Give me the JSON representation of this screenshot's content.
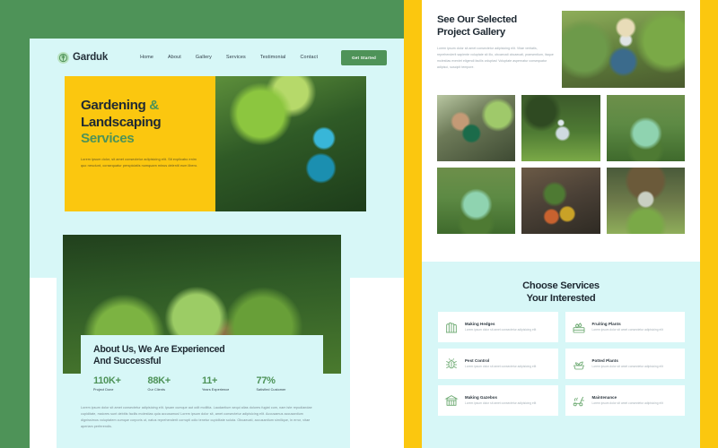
{
  "colors": {
    "frame_green": "#4e9358",
    "page_cyan": "#d7f7f7",
    "accent_yellow": "#fbc70f",
    "brand_green": "#4e9358",
    "heading_dark": "#1f2a33",
    "white": "#ffffff"
  },
  "navbar": {
    "brand_name": "Garduk",
    "brand_icon": "leaf-circle-icon",
    "links": [
      {
        "label": "Home"
      },
      {
        "label": "About"
      },
      {
        "label": "Gallery"
      },
      {
        "label": "Services"
      },
      {
        "label": "Testimonial"
      },
      {
        "label": "Contact"
      }
    ],
    "cta_label": "Get Started"
  },
  "hero": {
    "title_line1": "Gardening",
    "title_amp": "&",
    "title_line2": "Landscaping",
    "title_line3": "Services",
    "description": "Lorem ipsum dolor, sit amet consectetur adipisicing elit. Sit explicabo enim quo nesciunt, consequatur perspiciatis numquam minus deleniti eum libero.",
    "image_alt": "gardener-pruning-tree-photo"
  },
  "about": {
    "image_alt": "potted-herb-garden-photo",
    "title_line1": "About Us, We Are Experienced",
    "title_line2": "And Successful",
    "stats": [
      {
        "value": "110K+",
        "label": "Project Done"
      },
      {
        "value": "88K+",
        "label": "Our Clients"
      },
      {
        "value": "11+",
        "label": "Years Experience"
      },
      {
        "value": "77%",
        "label": "Satisfied Customer"
      }
    ],
    "paragraph": "Lorem ipsum dolor sit amet consectetur adipisicing elit. Ipsam cumque aut odit mollitia. Laudantium sequi alias dolores fugiat cum, nam iste repudiandae cupiditate, maiores sunt debitis facilis molestias quia accusamus! Lorem ipsum dolor sit, amet consectetur adipisicing elit. Accusamus accusantium dignissimos voluptatem cumque corporis ut, natus reprehenderit corrupti odio tenetur cupiditate soluta. Obcaecati, accusantium similique, in error, vitae aperiam perferendis."
  },
  "gallery": {
    "title_line1": "See Our Selected",
    "title_line2": "Project Gallery",
    "description": "Lorem ipsum dolor sit amet consectetur adipisicing elit. Vitae veritatis, reprehenderit sapiente voluptate sit illo, obcaecati obcaecati, praesentium, itaque molestias eveniet eligendi facilis voluptas! Voluptate aspernatur consequatur adipisci, suscipit tempore.",
    "hero_image_alt": "senior-gardener-harvesting-photo",
    "items": [
      {
        "alt": "man-with-watering-can-photo"
      },
      {
        "alt": "lawn-sprinkler-photo"
      },
      {
        "alt": "netted-vegetable-bed-photo"
      },
      {
        "alt": "netted-vegetable-bed-photo-2"
      },
      {
        "alt": "potted-plants-on-deck-photo"
      },
      {
        "alt": "garden-arch-trellis-photo"
      }
    ]
  },
  "services": {
    "title_line1": "Choose Services",
    "title_line2": "Your Interested",
    "items": [
      {
        "name": "Making Hedges",
        "icon": "hedge-icon",
        "description": "Lorem ipsum dolor sit amet consectetur adipisicing elit"
      },
      {
        "name": "Fruiting Plants",
        "icon": "fruit-crate-icon",
        "description": "Lorem ipsum dolor sit amet consectetur adipisicing elit"
      },
      {
        "name": "Pest Control",
        "icon": "bug-icon",
        "description": "Lorem ipsum dolor sit amet consectetur adipisicing elit"
      },
      {
        "name": "Potted Plants",
        "icon": "potted-plant-icon",
        "description": "Lorem ipsum dolor sit amet consectetur adipisicing elit"
      },
      {
        "name": "Making Gazebos",
        "icon": "gazebo-icon",
        "description": "Lorem ipsum dolor sit amet consectetur adipisicing elit"
      },
      {
        "name": "Maintenance",
        "icon": "lawn-mower-icon",
        "description": "Lorem ipsum dolor sit amet consectetur adipisicing elit"
      }
    ]
  }
}
